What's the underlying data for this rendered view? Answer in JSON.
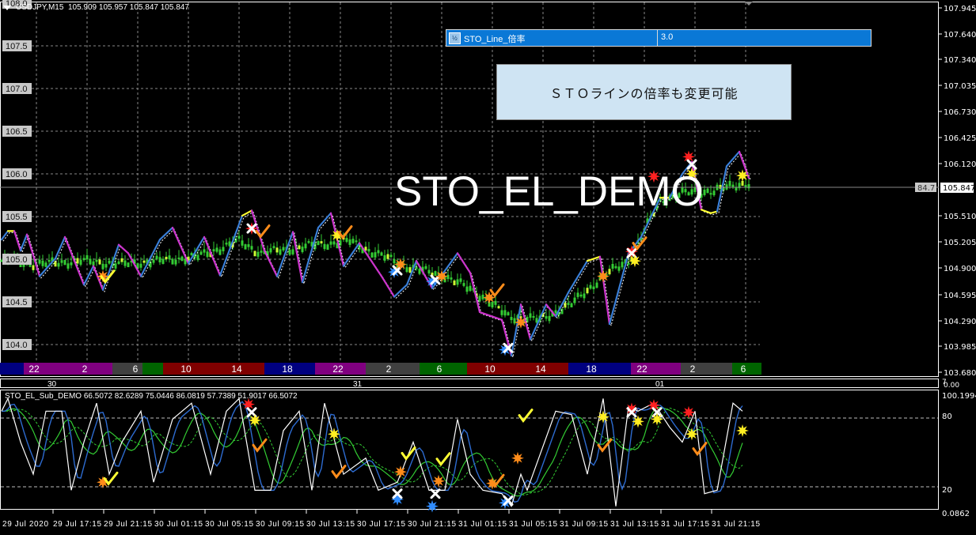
{
  "header": {
    "symbol_line": "USDJPY,M15  105.909 105.957 105.847 105.847"
  },
  "param_panel": {
    "icon": "½",
    "name": "STO_Line_倍率",
    "value": "3.0"
  },
  "note": "ＳＴＯラインの倍率も変更可能",
  "watermark": "STO_EL_DEMO",
  "sub_window": {
    "title": "STO_EL_Sub_DEMO 66.5072 82.6289 75.0446 86.0819 57.7389 51.9017 66.5072"
  },
  "left_price_labels": [
    "108.0",
    "107.5",
    "107.0",
    "106.5",
    "106.0",
    "105.5",
    "105.0",
    "104.5",
    "104.0"
  ],
  "right_price_labels": [
    "107.945",
    "107.640",
    "107.340",
    "107.035",
    "106.730",
    "106.425",
    "106.120",
    "105.510",
    "105.205",
    "104.900",
    "104.595",
    "104.290",
    "103.985",
    "103.680"
  ],
  "current_price": "105.847",
  "current_marker": "84.7",
  "sub_axis_labels": [
    "100.1994",
    "80",
    "20",
    "0.0862"
  ],
  "separator_labels": [
    "7",
    "0.00"
  ],
  "date_labels": [
    "30",
    "31",
    "01"
  ],
  "time_labels": [
    "29 Jul 2020",
    "29 Jul 17:15",
    "29 Jul 21:15",
    "30 Jul 01:15",
    "30 Jul 05:15",
    "30 Jul 09:15",
    "30 Jul 13:15",
    "30 Jul 17:15",
    "30 Jul 21:15",
    "31 Jul 01:15",
    "31 Jul 05:15",
    "31 Jul 09:15",
    "31 Jul 13:15",
    "31 Jul 17:15",
    "31 Jul 21:15"
  ],
  "session_bar": {
    "labels": [
      "22",
      "2",
      "6",
      "10",
      "14",
      "18",
      "22",
      "2",
      "6",
      "10",
      "14",
      "18",
      "22",
      "2",
      "6"
    ],
    "colors": {
      "asia": "#800080",
      "tokyo": "#404040",
      "pre_europe": "#006400",
      "europe": "#800000",
      "ny": "#000080"
    }
  },
  "colors": {
    "up": "#3a7fd8",
    "down": "#cc33cc",
    "flat": "#ffff33",
    "candles": "#33cc33",
    "sub_fast": "#ffffff",
    "sub_signal": "#2d6bd0",
    "sub_slow": "#33cc33"
  },
  "chart_data": [
    {
      "type": "line",
      "name_on_chart": "USDJPY,M15",
      "x_unit": "bar (M15)",
      "ylim": [
        103.68,
        107.945
      ],
      "price_line": [
        [
          0,
          105.23
        ],
        [
          2,
          105.33
        ],
        [
          4,
          105.33
        ],
        [
          6,
          105.1
        ],
        [
          8,
          105.29
        ],
        [
          12,
          104.8
        ],
        [
          17,
          105.01
        ],
        [
          20,
          105.26
        ],
        [
          26,
          104.7
        ],
        [
          29,
          104.92
        ],
        [
          32,
          104.64
        ],
        [
          37,
          105.17
        ],
        [
          40,
          105.07
        ],
        [
          44,
          104.8
        ],
        [
          50,
          105.23
        ],
        [
          54,
          105.37
        ],
        [
          59,
          104.95
        ],
        [
          64,
          105.26
        ],
        [
          69,
          104.81
        ],
        [
          76,
          105.51
        ],
        [
          79,
          105.57
        ],
        [
          83,
          105.1
        ],
        [
          87,
          104.8
        ],
        [
          92,
          105.32
        ],
        [
          95,
          104.73
        ],
        [
          100,
          105.37
        ],
        [
          104,
          105.54
        ],
        [
          108,
          104.92
        ],
        [
          113,
          105.19
        ],
        [
          120,
          104.8
        ],
        [
          124,
          104.56
        ],
        [
          128,
          104.7
        ],
        [
          131,
          104.98
        ],
        [
          136,
          104.66
        ],
        [
          144,
          105.07
        ],
        [
          148,
          104.84
        ],
        [
          151,
          104.38
        ],
        [
          158,
          104.29
        ],
        [
          161,
          103.87
        ],
        [
          164,
          104.47
        ],
        [
          167,
          104.06
        ],
        [
          172,
          104.47
        ],
        [
          175,
          104.33
        ],
        [
          179,
          104.61
        ],
        [
          185,
          104.98
        ],
        [
          189,
          105.03
        ],
        [
          192,
          104.24
        ],
        [
          198,
          105.07
        ],
        [
          202,
          105.26
        ],
        [
          208,
          105.72
        ],
        [
          211,
          105.72
        ],
        [
          215,
          106.0
        ],
        [
          218,
          106.14
        ],
        [
          221,
          105.58
        ],
        [
          224,
          105.54
        ],
        [
          226,
          105.56
        ],
        [
          229,
          106.09
        ],
        [
          233,
          106.26
        ],
        [
          236,
          105.95
        ]
      ],
      "average_line": [
        [
          0,
          104.98
        ],
        [
          12,
          104.94
        ],
        [
          25,
          104.98
        ],
        [
          38,
          104.94
        ],
        [
          50,
          104.98
        ],
        [
          62,
          105.03
        ],
        [
          75,
          105.21
        ],
        [
          82,
          105.07
        ],
        [
          100,
          105.17
        ],
        [
          110,
          105.21
        ],
        [
          118,
          105.07
        ],
        [
          130,
          104.89
        ],
        [
          140,
          104.8
        ],
        [
          150,
          104.61
        ],
        [
          160,
          104.33
        ],
        [
          170,
          104.29
        ],
        [
          180,
          104.47
        ],
        [
          190,
          104.8
        ],
        [
          198,
          104.98
        ],
        [
          202,
          105.26
        ],
        [
          208,
          105.68
        ],
        [
          215,
          105.77
        ],
        [
          225,
          105.8
        ],
        [
          235,
          105.89
        ]
      ],
      "markers": [
        {
          "bar": 32,
          "y": 104.8,
          "kind": "star",
          "color": "#ff8c1a"
        },
        {
          "bar": 33,
          "y": 104.78,
          "kind": "check",
          "color": "#ffff33"
        },
        {
          "bar": 79,
          "y": 105.36,
          "kind": "star",
          "color": "#ff2020"
        },
        {
          "bar": 79,
          "y": 105.36,
          "kind": "x",
          "color": "#ffffff"
        },
        {
          "bar": 82,
          "y": 105.31,
          "kind": "check",
          "color": "#ff8c1a"
        },
        {
          "bar": 106,
          "y": 105.28,
          "kind": "star",
          "color": "#ffee22"
        },
        {
          "bar": 108,
          "y": 105.3,
          "kind": "check",
          "color": "#ff8c1a"
        },
        {
          "bar": 124,
          "y": 104.85,
          "kind": "star",
          "color": "#2f8cff"
        },
        {
          "bar": 125,
          "y": 104.87,
          "kind": "x",
          "color": "#ffffff"
        },
        {
          "bar": 126,
          "y": 104.94,
          "kind": "star",
          "color": "#ff8c1a"
        },
        {
          "bar": 136,
          "y": 104.74,
          "kind": "star",
          "color": "#2f8cff"
        },
        {
          "bar": 137,
          "y": 104.76,
          "kind": "x",
          "color": "#ffffff"
        },
        {
          "bar": 139,
          "y": 104.8,
          "kind": "star",
          "color": "#ff8c1a"
        },
        {
          "bar": 154,
          "y": 104.55,
          "kind": "star",
          "color": "#ff8c1a"
        },
        {
          "bar": 156,
          "y": 104.62,
          "kind": "check",
          "color": "#ff8c1a"
        },
        {
          "bar": 159,
          "y": 103.94,
          "kind": "star",
          "color": "#2f8cff"
        },
        {
          "bar": 160,
          "y": 103.96,
          "kind": "x",
          "color": "#ffffff"
        },
        {
          "bar": 164,
          "y": 104.26,
          "kind": "star",
          "color": "#ff8c1a"
        },
        {
          "bar": 190,
          "y": 104.8,
          "kind": "star",
          "color": "#ff8c1a"
        },
        {
          "bar": 199,
          "y": 105.09,
          "kind": "star",
          "color": "#ff2020"
        },
        {
          "bar": 199,
          "y": 105.07,
          "kind": "x",
          "color": "#ffffff"
        },
        {
          "bar": 200,
          "y": 104.98,
          "kind": "star",
          "color": "#ffee22"
        },
        {
          "bar": 201,
          "y": 105.17,
          "kind": "check",
          "color": "#ff8c1a"
        },
        {
          "bar": 206,
          "y": 105.97,
          "kind": "star",
          "color": "#ff2020"
        },
        {
          "bar": 217,
          "y": 106.2,
          "kind": "star",
          "color": "#ff2020"
        },
        {
          "bar": 218,
          "y": 106.11,
          "kind": "x",
          "color": "#ffffff"
        },
        {
          "bar": 218,
          "y": 106.0,
          "kind": "star",
          "color": "#ffee22"
        },
        {
          "bar": 234,
          "y": 105.98,
          "kind": "star",
          "color": "#ffee22"
        }
      ]
    },
    {
      "type": "line",
      "name_on_chart": "STO_EL_Sub_DEMO",
      "ylim": [
        0.0862,
        100.1994
      ],
      "levels": [
        80,
        20
      ],
      "main_line": [
        [
          0,
          86
        ],
        [
          2,
          97
        ],
        [
          6,
          59
        ],
        [
          10,
          31
        ],
        [
          14,
          86
        ],
        [
          19,
          86
        ],
        [
          22,
          17
        ],
        [
          26,
          59
        ],
        [
          30,
          93
        ],
        [
          34,
          31
        ],
        [
          38,
          59
        ],
        [
          44,
          86
        ],
        [
          48,
          24
        ],
        [
          54,
          79
        ],
        [
          60,
          93
        ],
        [
          66,
          31
        ],
        [
          71,
          86
        ],
        [
          75,
          97
        ],
        [
          80,
          17
        ],
        [
          85,
          17
        ],
        [
          89,
          69
        ],
        [
          94,
          86
        ],
        [
          98,
          17
        ],
        [
          102,
          93
        ],
        [
          108,
          31
        ],
        [
          115,
          45
        ],
        [
          119,
          17
        ],
        [
          125,
          24
        ],
        [
          130,
          59
        ],
        [
          135,
          17
        ],
        [
          140,
          17
        ],
        [
          144,
          79
        ],
        [
          148,
          31
        ],
        [
          152,
          17
        ],
        [
          158,
          14
        ],
        [
          161,
          3
        ],
        [
          164,
          31
        ],
        [
          166,
          17
        ],
        [
          175,
          86
        ],
        [
          180,
          83
        ],
        [
          185,
          31
        ],
        [
          190,
          97
        ],
        [
          194,
          3
        ],
        [
          198,
          90
        ],
        [
          201,
          86
        ],
        [
          206,
          93
        ],
        [
          211,
          72
        ],
        [
          215,
          59
        ],
        [
          219,
          86
        ],
        [
          222,
          14
        ],
        [
          226,
          17
        ],
        [
          231,
          93
        ],
        [
          234,
          86
        ]
      ],
      "markers": [
        {
          "bar": 32,
          "y": 24,
          "kind": "star",
          "color": "#ff8c1a"
        },
        {
          "bar": 34,
          "y": 26,
          "kind": "check",
          "color": "#ffff33"
        },
        {
          "bar": 78,
          "y": 92,
          "kind": "star",
          "color": "#ff2020"
        },
        {
          "bar": 79,
          "y": 85,
          "kind": "x",
          "color": "#ffffff"
        },
        {
          "bar": 80,
          "y": 78,
          "kind": "star",
          "color": "#ffee22"
        },
        {
          "bar": 81,
          "y": 55,
          "kind": "check",
          "color": "#ff8c1a"
        },
        {
          "bar": 105,
          "y": 66,
          "kind": "star",
          "color": "#ffee22"
        },
        {
          "bar": 106,
          "y": 32,
          "kind": "check",
          "color": "#ff8c1a"
        },
        {
          "bar": 125,
          "y": 9,
          "kind": "star",
          "color": "#2f8cff"
        },
        {
          "bar": 125,
          "y": 14,
          "kind": "x",
          "color": "#ffffff"
        },
        {
          "bar": 126,
          "y": 33,
          "kind": "star",
          "color": "#ff8c1a"
        },
        {
          "bar": 128,
          "y": 48,
          "kind": "check",
          "color": "#ffff33"
        },
        {
          "bar": 136,
          "y": 3,
          "kind": "star",
          "color": "#2f8cff"
        },
        {
          "bar": 137,
          "y": 14,
          "kind": "x",
          "color": "#ffffff"
        },
        {
          "bar": 138,
          "y": 25,
          "kind": "star",
          "color": "#ff8c1a"
        },
        {
          "bar": 139,
          "y": 43,
          "kind": "check",
          "color": "#ffff33"
        },
        {
          "bar": 155,
          "y": 23,
          "kind": "star",
          "color": "#ff8c1a"
        },
        {
          "bar": 156,
          "y": 24,
          "kind": "check",
          "color": "#ff8c1a"
        },
        {
          "bar": 159,
          "y": 6,
          "kind": "star",
          "color": "#2f8cff"
        },
        {
          "bar": 160,
          "y": 8,
          "kind": "x",
          "color": "#ffffff"
        },
        {
          "bar": 163,
          "y": 45,
          "kind": "star",
          "color": "#ff8c1a"
        },
        {
          "bar": 165,
          "y": 81,
          "kind": "check",
          "color": "#ffff33"
        },
        {
          "bar": 190,
          "y": 81,
          "kind": "star",
          "color": "#ffee22"
        },
        {
          "bar": 190,
          "y": 55,
          "kind": "check",
          "color": "#ff8c1a"
        },
        {
          "bar": 199,
          "y": 88,
          "kind": "star",
          "color": "#ff2020"
        },
        {
          "bar": 199,
          "y": 85,
          "kind": "x",
          "color": "#ffffff"
        },
        {
          "bar": 201,
          "y": 77,
          "kind": "star",
          "color": "#ffee22"
        },
        {
          "bar": 206,
          "y": 91,
          "kind": "star",
          "color": "#ff2020"
        },
        {
          "bar": 207,
          "y": 85,
          "kind": "x",
          "color": "#ffffff"
        },
        {
          "bar": 207,
          "y": 79,
          "kind": "star",
          "color": "#ffee22"
        },
        {
          "bar": 217,
          "y": 85,
          "kind": "star",
          "color": "#ff2020"
        },
        {
          "bar": 218,
          "y": 66,
          "kind": "star",
          "color": "#ffee22"
        },
        {
          "bar": 220,
          "y": 52,
          "kind": "check",
          "color": "#ff8c1a"
        },
        {
          "bar": 234,
          "y": 69,
          "kind": "star",
          "color": "#ffee22"
        }
      ]
    }
  ]
}
